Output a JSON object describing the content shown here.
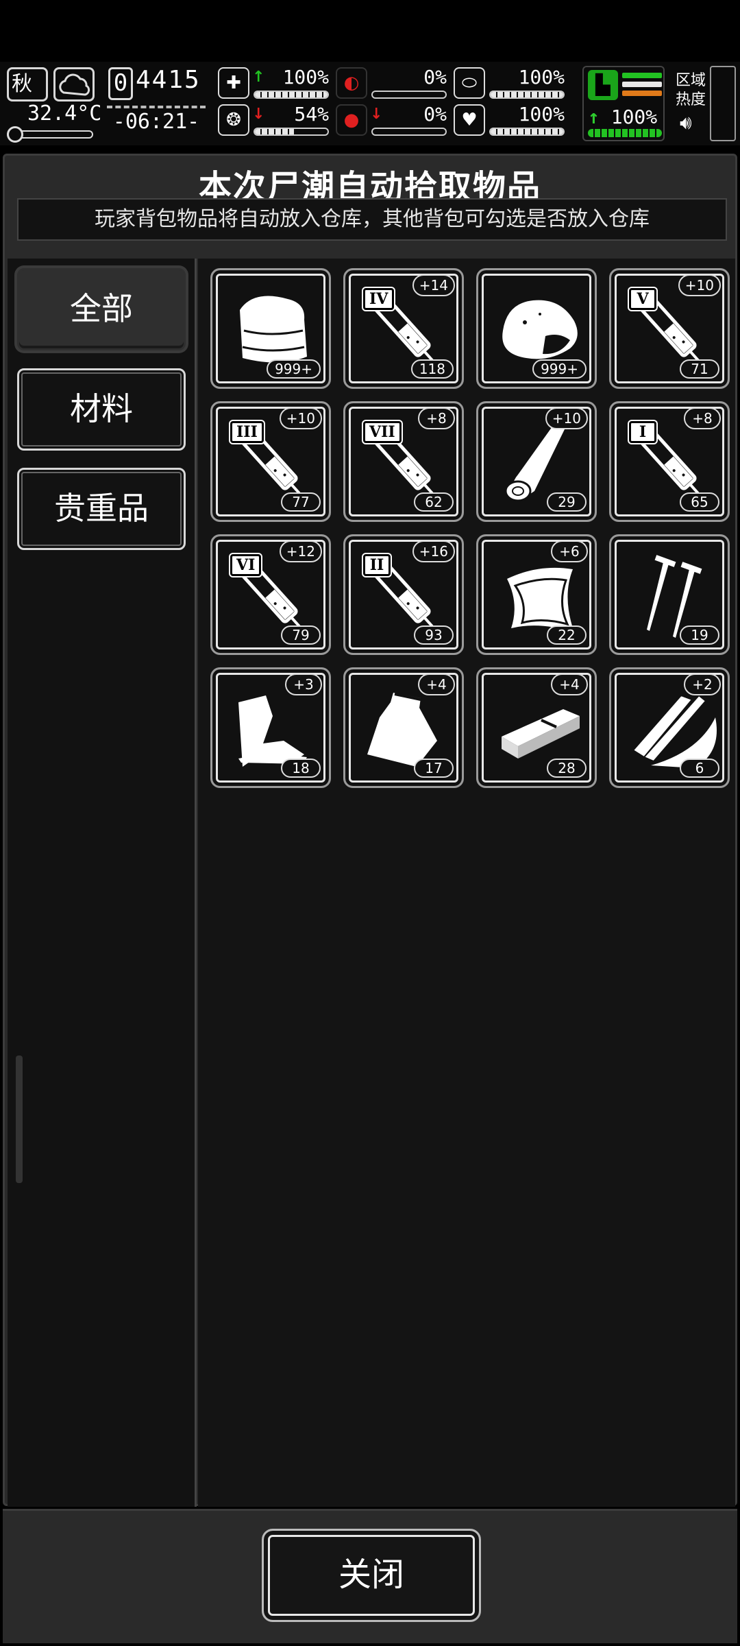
{
  "hud": {
    "season": "秋",
    "temperature": "32.4°C",
    "day_box": "0",
    "day_rest": "4415",
    "clock": "-06:21-",
    "stats": [
      {
        "name": "health",
        "icon": "medkit-icon",
        "glyph": "✚",
        "arrow": "↑",
        "arrow_color": "#22c322",
        "value": "100%",
        "level": 1.0,
        "col": 0,
        "row": 0
      },
      {
        "name": "hunger",
        "icon": "stomach-icon",
        "glyph": "◐",
        "arrow": "",
        "arrow_color": "#e02020",
        "value": "0%",
        "level": 0.0,
        "col": 1,
        "row": 0,
        "icon_color": "#e02020"
      },
      {
        "name": "pill",
        "icon": "pill-icon",
        "glyph": "⬭",
        "arrow": "",
        "arrow_color": "#fff",
        "value": "100%",
        "level": 1.0,
        "col": 2,
        "row": 0
      },
      {
        "name": "sanity",
        "icon": "brain-icon",
        "glyph": "❂",
        "arrow": "↓",
        "arrow_color": "#e02020",
        "value": "54%",
        "level": 0.54,
        "col": 0,
        "row": 1
      },
      {
        "name": "thirst",
        "icon": "blood-drop-icon",
        "glyph": "●",
        "arrow": "↓",
        "arrow_color": "#e02020",
        "value": "0%",
        "level": 0.0,
        "col": 1,
        "row": 1,
        "icon_color": "#e02020"
      },
      {
        "name": "heart",
        "icon": "heart-icon",
        "glyph": "♥",
        "arrow": "",
        "arrow_color": "#fff",
        "value": "100%",
        "level": 1.0,
        "col": 2,
        "row": 1
      }
    ],
    "stamina": {
      "arrow": "↑",
      "value": "100%",
      "level": 1.0
    },
    "zone_label": [
      "区域",
      "热度"
    ],
    "colors": {
      "green": "#22c322",
      "orange": "#e07a1a",
      "white": "#e8e8e8",
      "red": "#e02020"
    }
  },
  "panel": {
    "title": "本次尸潮自动拾取物品",
    "subtitle": "玩家背包物品将自动放入仓库，其他背包可勾选是否放入仓库"
  },
  "tabs": [
    {
      "label": "全部",
      "active": true
    },
    {
      "label": "材料",
      "active": false
    },
    {
      "label": "贵重品",
      "active": false
    }
  ],
  "items": [
    {
      "icon": "cloth-icon",
      "count": "999+",
      "plus": "",
      "roman": ""
    },
    {
      "icon": "syringe-icon",
      "count": "118",
      "plus": "+14",
      "roman": "IV"
    },
    {
      "icon": "meat-icon",
      "count": "999+",
      "plus": "",
      "roman": ""
    },
    {
      "icon": "syringe-icon",
      "count": "71",
      "plus": "+10",
      "roman": "V"
    },
    {
      "icon": "syringe-icon",
      "count": "77",
      "plus": "+10",
      "roman": "III"
    },
    {
      "icon": "syringe-icon",
      "count": "62",
      "plus": "+8",
      "roman": "VII"
    },
    {
      "icon": "log-icon",
      "count": "29",
      "plus": "+10",
      "roman": ""
    },
    {
      "icon": "syringe-icon",
      "count": "65",
      "plus": "+8",
      "roman": "I"
    },
    {
      "icon": "syringe-icon",
      "count": "79",
      "plus": "+12",
      "roman": "VI"
    },
    {
      "icon": "syringe-icon",
      "count": "93",
      "plus": "+16",
      "roman": "II"
    },
    {
      "icon": "leather-icon",
      "count": "22",
      "plus": "+6",
      "roman": ""
    },
    {
      "icon": "nails-icon",
      "count": "19",
      "plus": "",
      "roman": ""
    },
    {
      "icon": "scrap-icon",
      "count": "18",
      "plus": "+3",
      "roman": ""
    },
    {
      "icon": "bag-icon",
      "count": "17",
      "plus": "+4",
      "roman": ""
    },
    {
      "icon": "plank-icon",
      "count": "28",
      "plus": "+4",
      "roman": ""
    },
    {
      "icon": "wood-shavings-icon",
      "count": "6",
      "plus": "+2",
      "roman": ""
    }
  ],
  "footer": {
    "close_label": "关闭"
  }
}
